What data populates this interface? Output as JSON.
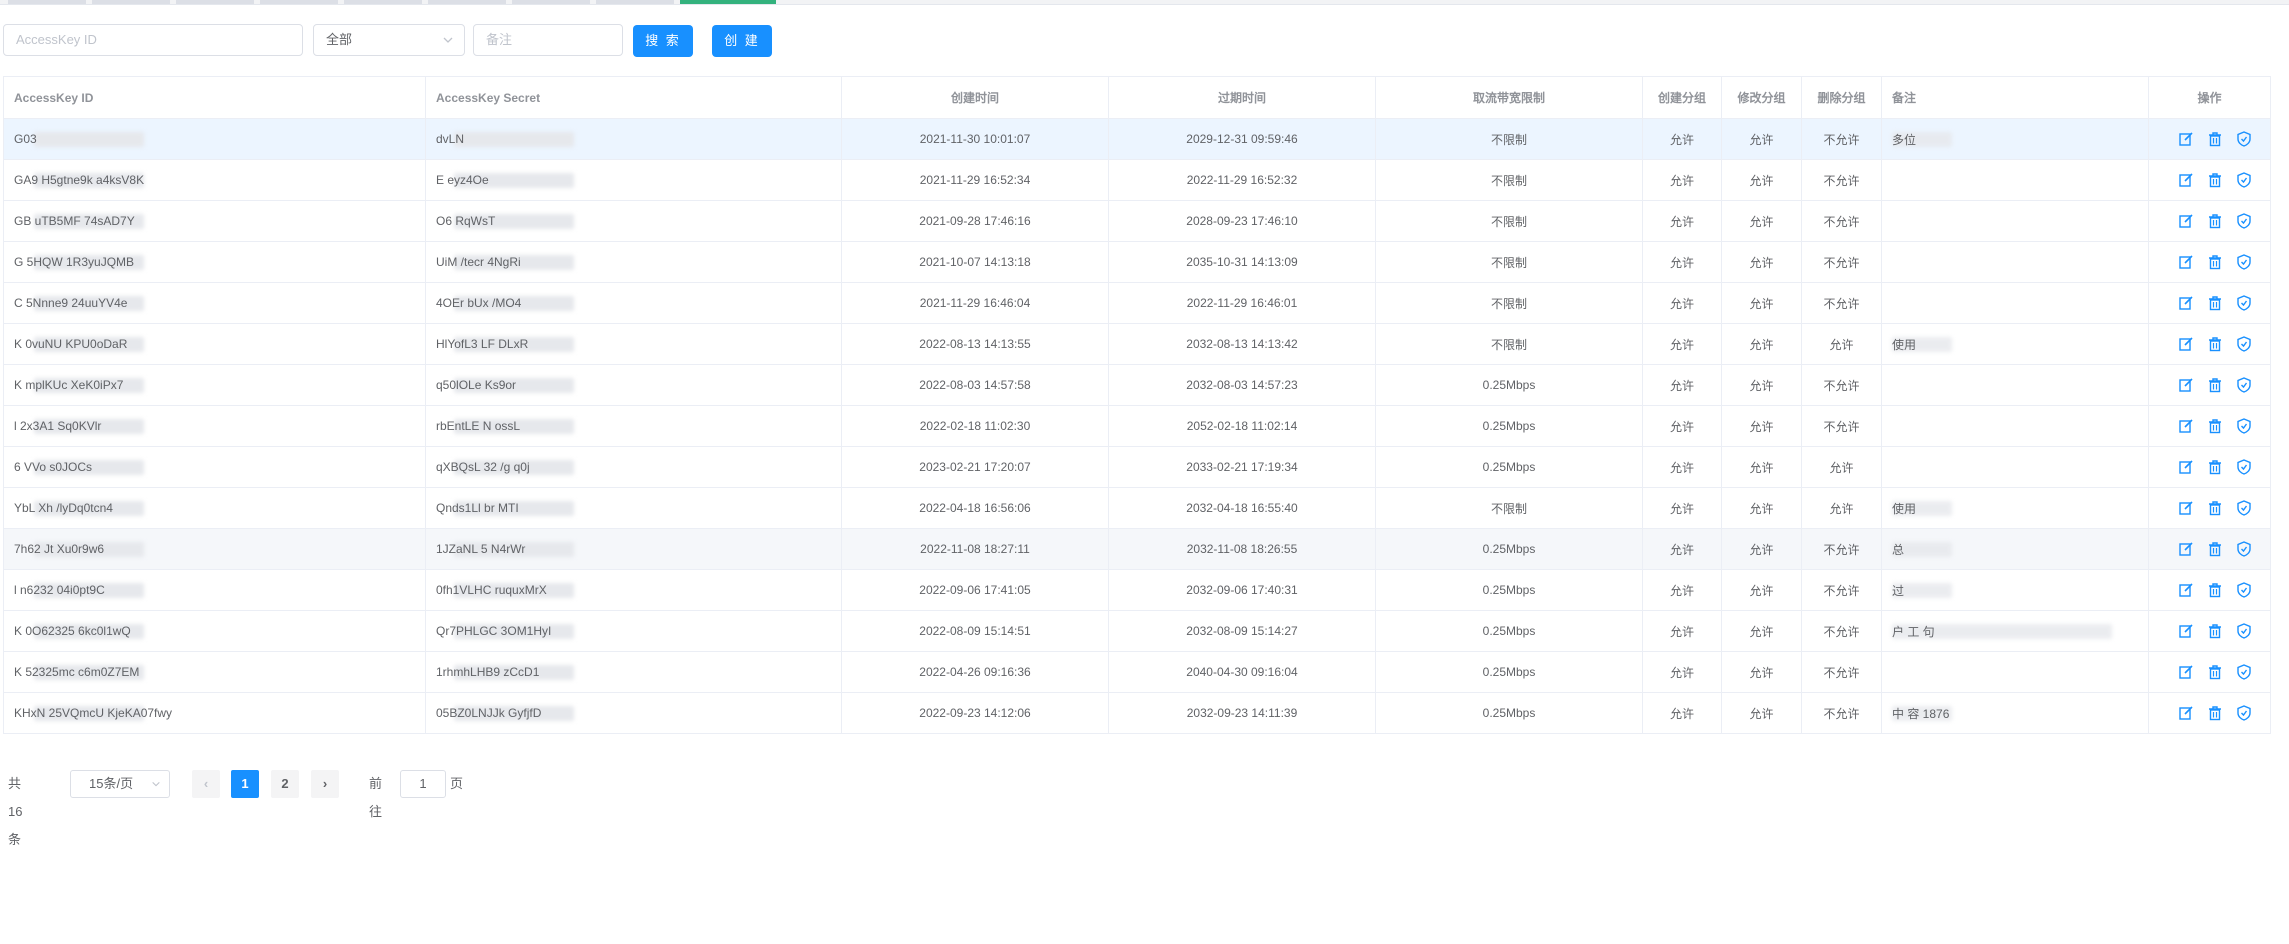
{
  "filters": {
    "access_key_placeholder": "AccessKey ID",
    "group_select_value": "全部",
    "remark_placeholder": "备注",
    "search_label": "搜 索",
    "create_label": "创 建"
  },
  "table": {
    "columns": [
      "AccessKey ID",
      "AccessKey Secret",
      "创建时间",
      "过期时间",
      "取流带宽限制",
      "创建分组",
      "修改分组",
      "删除分组",
      "备注",
      "操作"
    ],
    "rows": [
      {
        "id": "G03",
        "secret": "dvLN",
        "created": "2021-11-30 10:01:07",
        "expires": "2029-12-31 09:59:46",
        "bandwidth": "不限制",
        "create_group": "允许",
        "modify_group": "允许",
        "delete_group": "不允许",
        "remark": "多位"
      },
      {
        "id": "GA9 H5gtne9k a4ksV8K",
        "secret": "E eyz4Oe",
        "created": "2021-11-29 16:52:34",
        "expires": "2022-11-29 16:52:32",
        "bandwidth": "不限制",
        "create_group": "允许",
        "modify_group": "允许",
        "delete_group": "不允许",
        "remark": ""
      },
      {
        "id": "GB uTB5MF 74sAD7Y",
        "secret": "O6 RqWsT",
        "created": "2021-09-28 17:46:16",
        "expires": "2028-09-23 17:46:10",
        "bandwidth": "不限制",
        "create_group": "允许",
        "modify_group": "允许",
        "delete_group": "不允许",
        "remark": ""
      },
      {
        "id": "G 5HQW 1R3yuJQMB",
        "secret": "UiM /tecr 4NgRi",
        "created": "2021-10-07 14:13:18",
        "expires": "2035-10-31 14:13:09",
        "bandwidth": "不限制",
        "create_group": "允许",
        "modify_group": "允许",
        "delete_group": "不允许",
        "remark": ""
      },
      {
        "id": "C 5Nnne9 24uuYV4e",
        "secret": "4OEr bUx /MO4",
        "created": "2021-11-29 16:46:04",
        "expires": "2022-11-29 16:46:01",
        "bandwidth": "不限制",
        "create_group": "允许",
        "modify_group": "允许",
        "delete_group": "不允许",
        "remark": ""
      },
      {
        "id": "K 0vuNU KPU0oDaR",
        "secret": "HlYofL3 LF DLxR",
        "created": "2022-08-13 14:13:55",
        "expires": "2032-08-13 14:13:42",
        "bandwidth": "不限制",
        "create_group": "允许",
        "modify_group": "允许",
        "delete_group": "允许",
        "remark": "使用"
      },
      {
        "id": "K mplKUc XeK0iPx7",
        "secret": "q50lOLe Ks9or",
        "created": "2022-08-03 14:57:58",
        "expires": "2032-08-03 14:57:23",
        "bandwidth": "0.25Mbps",
        "create_group": "允许",
        "modify_group": "允许",
        "delete_group": "不允许",
        "remark": ""
      },
      {
        "id": "l 2x3A1 Sq0KVlr",
        "secret": "rbEntLE N ossL",
        "created": "2022-02-18 11:02:30",
        "expires": "2052-02-18 11:02:14",
        "bandwidth": "0.25Mbps",
        "create_group": "允许",
        "modify_group": "允许",
        "delete_group": "不允许",
        "remark": ""
      },
      {
        "id": "6 VVo s0JOCs",
        "secret": "qXBQsL 32 /g q0j",
        "created": "2023-02-21 17:20:07",
        "expires": "2033-02-21 17:19:34",
        "bandwidth": "0.25Mbps",
        "create_group": "允许",
        "modify_group": "允许",
        "delete_group": "允许",
        "remark": ""
      },
      {
        "id": "YbL Xh /lyDq0tcn4",
        "secret": "Qnds1Ll br MTI",
        "created": "2022-04-18 16:56:06",
        "expires": "2032-04-18 16:55:40",
        "bandwidth": "不限制",
        "create_group": "允许",
        "modify_group": "允许",
        "delete_group": "允许",
        "remark": "使用"
      },
      {
        "id": "7h62 Jt Xu0r9w6",
        "secret": "1JZaNL 5 N4rWr",
        "created": "2022-11-08 18:27:11",
        "expires": "2032-11-08 18:26:55",
        "bandwidth": "0.25Mbps",
        "create_group": "允许",
        "modify_group": "允许",
        "delete_group": "不允许",
        "remark": "总"
      },
      {
        "id": "l n6232 04i0pt9C",
        "secret": "0fh1VLHC ruquxMrX",
        "created": "2022-09-06 17:41:05",
        "expires": "2032-09-06 17:40:31",
        "bandwidth": "0.25Mbps",
        "create_group": "允许",
        "modify_group": "允许",
        "delete_group": "不允许",
        "remark": "过"
      },
      {
        "id": "K 0O62325 6kc0l1wQ",
        "secret": "Qr7PHLGC 3OM1HyI",
        "created": "2022-08-09 15:14:51",
        "expires": "2032-08-09 15:14:27",
        "bandwidth": "0.25Mbps",
        "create_group": "允许",
        "modify_group": "允许",
        "delete_group": "不允许",
        "remark": "户 工 句"
      },
      {
        "id": "K 52325mc c6m0Z7EM",
        "secret": "1rhmhLHB9 zCcD1",
        "created": "2022-04-26 09:16:36",
        "expires": "2040-04-30 09:16:04",
        "bandwidth": "0.25Mbps",
        "create_group": "允许",
        "modify_group": "允许",
        "delete_group": "不允许",
        "remark": ""
      },
      {
        "id": "KHxN 25VQmcU KjeKA07fwy",
        "secret": "05BZ0LNJJk GyfjfD",
        "created": "2022-09-23 14:12:06",
        "expires": "2032-09-23 14:11:39",
        "bandwidth": "0.25Mbps",
        "create_group": "允许",
        "modify_group": "允许",
        "delete_group": "不允许",
        "remark": "中 容 1876"
      }
    ]
  },
  "pagination": {
    "total_label": "共 16 条",
    "page_size_value": "15条/页",
    "pages": [
      "1",
      "2"
    ],
    "current_page": "1",
    "goto_prefix": "前往",
    "goto_value": "1",
    "goto_suffix": "页"
  },
  "colors": {
    "primary": "#1890ff",
    "row_highlight": "#ecf5ff",
    "border": "#ebeef5"
  },
  "icons": [
    "edit-icon",
    "delete-icon",
    "shield-icon"
  ]
}
